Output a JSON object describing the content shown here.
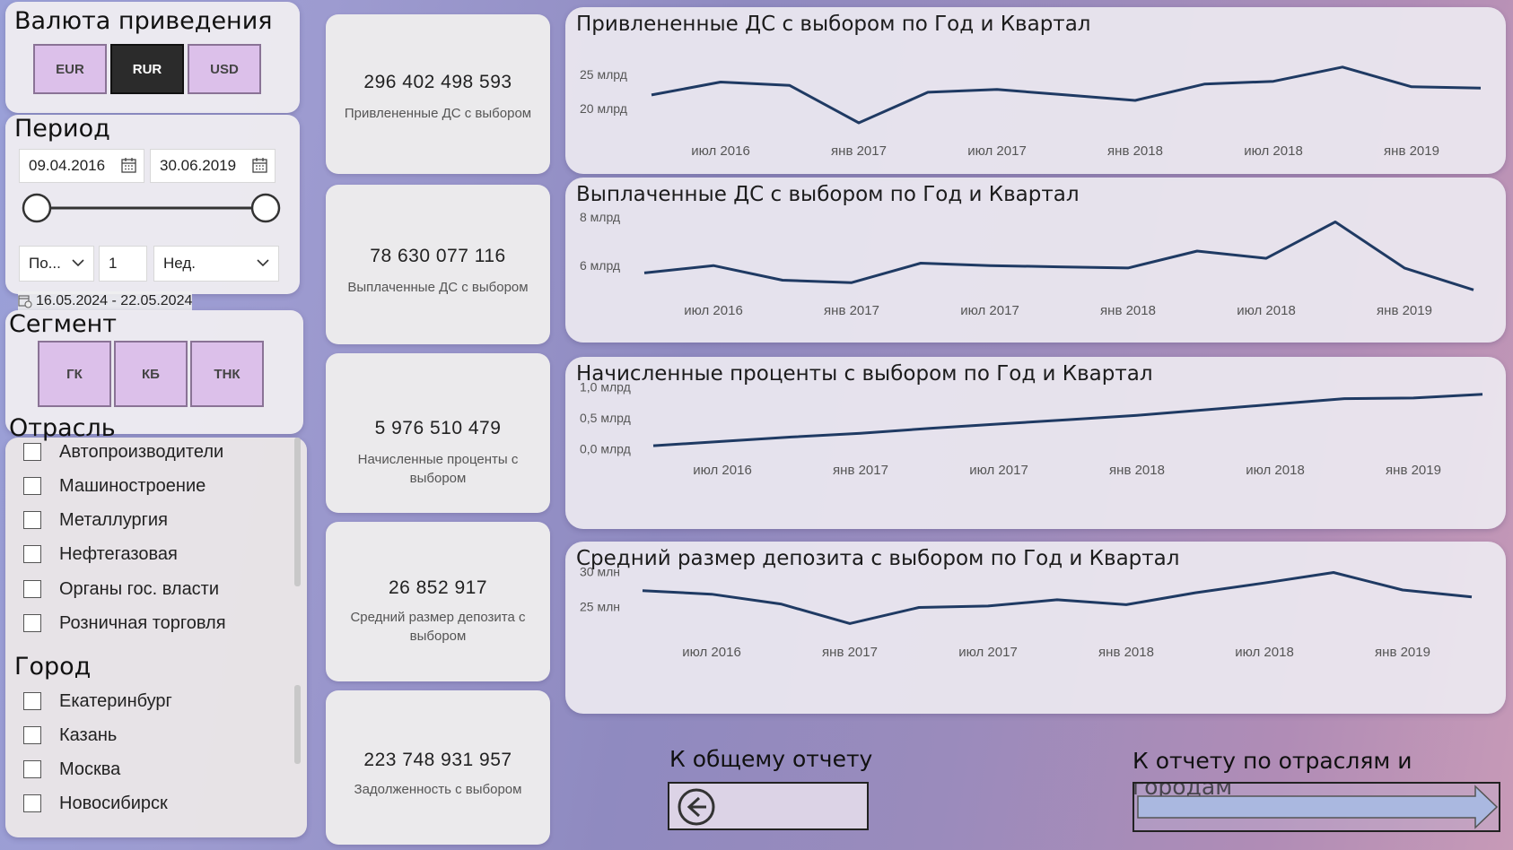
{
  "currency": {
    "title": "Валюта приведения",
    "options": [
      "EUR",
      "RUR",
      "USD"
    ],
    "selected": "RUR"
  },
  "period": {
    "title": "Период",
    "start_date": "09.04.2016",
    "end_date": "30.06.2019",
    "relative_type": "По...",
    "relative_count": "1",
    "relative_unit": "Нед.",
    "relative_range": "16.05.2024 - 22.05.2024"
  },
  "segment": {
    "title": "Сегмент",
    "options": [
      "ГК",
      "КБ",
      "ТНК"
    ]
  },
  "industry": {
    "title": "Отрасль",
    "items": [
      "Автопроизводители",
      "Машиностроение",
      "Металлургия",
      "Нефтегазовая",
      "Органы гос. власти",
      "Розничная торговля"
    ]
  },
  "city": {
    "title": "Город",
    "items": [
      "Екатеринбург",
      "Казань",
      "Москва",
      "Новосибирск"
    ]
  },
  "kpis": [
    {
      "value": "296 402 498 593",
      "label": "Привлененные ДС с выбором"
    },
    {
      "value": "78 630 077 116",
      "label": "Выплаченные ДС с выбором"
    },
    {
      "value": "5 976 510 479",
      "label": "Начисленные проценты с выбором"
    },
    {
      "value": "26 852 917",
      "label": "Средний размер депозита с выбором"
    },
    {
      "value": "223 748 931 957",
      "label": "Задолженность с выбором"
    }
  ],
  "chart_data": [
    {
      "type": "line",
      "title": "Привлененные ДС с выбором по Год и Квартал",
      "x": [
        "2016 Q2",
        "2016 Q3",
        "2016 Q4",
        "2017 Q1",
        "2017 Q2",
        "2017 Q3",
        "2017 Q4",
        "2018 Q1",
        "2018 Q2",
        "2018 Q3",
        "2018 Q4",
        "2019 Q1",
        "2019 Q2"
      ],
      "x_tick_labels": [
        "июл 2016",
        "янв 2017",
        "июл 2017",
        "янв 2018",
        "июл 2018",
        "янв 2019"
      ],
      "y_tick_labels": [
        "25 млрд",
        "20 млрд"
      ],
      "y_ticks": [
        25,
        20
      ],
      "ylim": [
        17.5,
        27
      ],
      "y_unit": "млрд",
      "values": [
        22.0,
        23.9,
        23.4,
        17.9,
        22.4,
        22.8,
        22.0,
        21.2,
        23.6,
        24.0,
        26.1,
        23.2,
        23.0
      ],
      "color": "#1f3a63"
    },
    {
      "type": "line",
      "title": "Выплаченные ДС с выбором по Год и Квартал",
      "x": [
        "2016 Q2",
        "2016 Q3",
        "2016 Q4",
        "2017 Q1",
        "2017 Q2",
        "2017 Q3",
        "2017 Q4",
        "2018 Q1",
        "2018 Q2",
        "2018 Q3",
        "2018 Q4",
        "2019 Q1",
        "2019 Q2"
      ],
      "x_tick_labels": [
        "июл 2016",
        "янв 2017",
        "июл 2017",
        "янв 2018",
        "июл 2018",
        "янв 2019"
      ],
      "y_tick_labels": [
        "8 млрд",
        "6 млрд"
      ],
      "y_ticks": [
        8,
        6
      ],
      "ylim": [
        4.9,
        8.3
      ],
      "y_unit": "млрд",
      "values": [
        5.7,
        6.0,
        5.4,
        5.3,
        6.1,
        6.0,
        5.95,
        5.9,
        6.6,
        6.3,
        7.8,
        5.9,
        5.0
      ],
      "color": "#1f3a63"
    },
    {
      "type": "line",
      "title": "Начисленные проценты с выбором по Год и Квартал",
      "x": [
        "2016 Q2",
        "2016 Q3",
        "2016 Q4",
        "2017 Q1",
        "2017 Q2",
        "2017 Q3",
        "2017 Q4",
        "2018 Q1",
        "2018 Q2",
        "2018 Q3",
        "2018 Q4",
        "2019 Q1",
        "2019 Q2"
      ],
      "x_tick_labels": [
        "июл 2016",
        "янв 2017",
        "июл 2017",
        "янв 2018",
        "июл 2018",
        "янв 2019"
      ],
      "y_tick_labels": [
        "1,0 млрд",
        "0,5 млрд",
        "0,0 млрд"
      ],
      "y_ticks": [
        1.0,
        0.5,
        0.0
      ],
      "ylim": [
        -0.05,
        1.05
      ],
      "y_unit": "млрд",
      "values": [
        0.05,
        0.12,
        0.19,
        0.25,
        0.33,
        0.4,
        0.47,
        0.54,
        0.63,
        0.72,
        0.81,
        0.82,
        0.88
      ],
      "color": "#1f3a63"
    },
    {
      "type": "line",
      "title": "Средний размер депозита с выбором по Год и Квартал",
      "x": [
        "2016 Q2",
        "2016 Q3",
        "2016 Q4",
        "2017 Q1",
        "2017 Q2",
        "2017 Q3",
        "2017 Q4",
        "2018 Q1",
        "2018 Q2",
        "2018 Q3",
        "2018 Q4",
        "2019 Q1",
        "2019 Q2"
      ],
      "x_tick_labels": [
        "июл 2016",
        "янв 2017",
        "июл 2017",
        "янв 2018",
        "июл 2018",
        "янв 2019"
      ],
      "y_tick_labels": [
        "30 млн",
        "25 млн"
      ],
      "y_ticks": [
        30,
        25
      ],
      "ylim": [
        21.5,
        31.5
      ],
      "y_unit": "млн",
      "values": [
        27.3,
        26.8,
        25.4,
        22.6,
        24.9,
        25.1,
        26.0,
        25.3,
        27.0,
        28.4,
        29.9,
        27.4,
        26.4
      ],
      "color": "#1f3a63"
    }
  ],
  "nav": {
    "back_title": "К общему  отчету",
    "forward_title": "К отчету по отраслям и городам"
  }
}
